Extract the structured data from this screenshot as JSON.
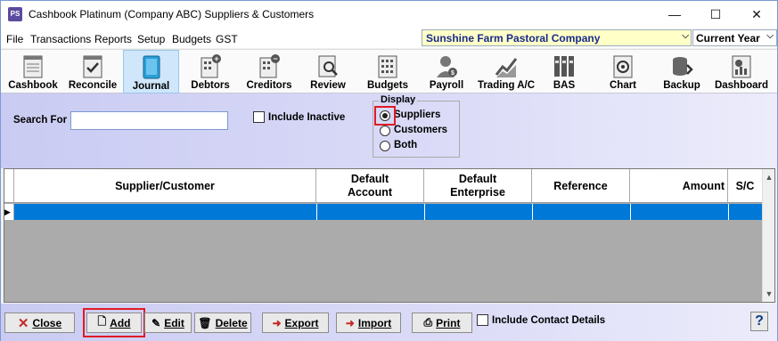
{
  "window": {
    "title": "Cashbook Platinum (Company ABC)  Suppliers & Customers",
    "app_icon_text": "PS",
    "controls": {
      "minimize": "—",
      "maximize": "☐",
      "close": "✕"
    }
  },
  "menu": [
    "File",
    "Transactions",
    "Reports",
    "Setup",
    "Budgets",
    "GST"
  ],
  "company_select": {
    "value": "Sunshine Farm Pastoral Company"
  },
  "year_select": {
    "value": "Current Year"
  },
  "toolbar": [
    {
      "label": "Cashbook",
      "icon": "cashbook-icon"
    },
    {
      "label": "Reconcile",
      "icon": "reconcile-icon"
    },
    {
      "label": "Journal",
      "icon": "journal-icon"
    },
    {
      "label": "Debtors",
      "icon": "debtors-icon"
    },
    {
      "label": "Creditors",
      "icon": "creditors-icon"
    },
    {
      "label": "Review",
      "icon": "review-icon"
    },
    {
      "label": "Budgets",
      "icon": "budgets-icon"
    },
    {
      "label": "Payroll",
      "icon": "payroll-icon"
    },
    {
      "label": "Trading A/C",
      "icon": "trading-icon"
    },
    {
      "label": "BAS",
      "icon": "bas-icon"
    },
    {
      "label": "Chart",
      "icon": "chart-icon"
    },
    {
      "label": "Backup",
      "icon": "backup-icon"
    },
    {
      "label": "Dashboard",
      "icon": "dashboard-icon"
    }
  ],
  "search": {
    "label": "Search For",
    "value": "",
    "include_inactive_label": "Include Inactive",
    "include_inactive_checked": false
  },
  "display": {
    "title": "Display",
    "options": [
      "Suppliers",
      "Customers",
      "Both"
    ],
    "selected": "Suppliers"
  },
  "grid": {
    "columns": [
      "Supplier/Customer",
      "Default\nAccount",
      "Default\nEnterprise",
      "Reference",
      "Amount",
      "S/C"
    ],
    "row_indicator": "▶"
  },
  "buttons": {
    "close": {
      "label": "Close",
      "icon": "close-x-icon"
    },
    "add": {
      "label": "Add",
      "icon": "new-page-icon"
    },
    "edit": {
      "label": "Edit",
      "icon": "edit-icon"
    },
    "delete": {
      "label": "Delete",
      "icon": "trash-icon"
    },
    "export": {
      "label": "Export",
      "icon": "export-icon"
    },
    "import": {
      "label": "Import",
      "icon": "import-icon"
    },
    "print": {
      "label": "Print",
      "icon": "printer-icon"
    }
  },
  "include_contact_details": {
    "label": "Include Contact Details",
    "checked": false
  },
  "help": "?",
  "colors": {
    "accent": "#0078d7",
    "highlight": "#e01b24",
    "panel": "#d6d6f5"
  }
}
